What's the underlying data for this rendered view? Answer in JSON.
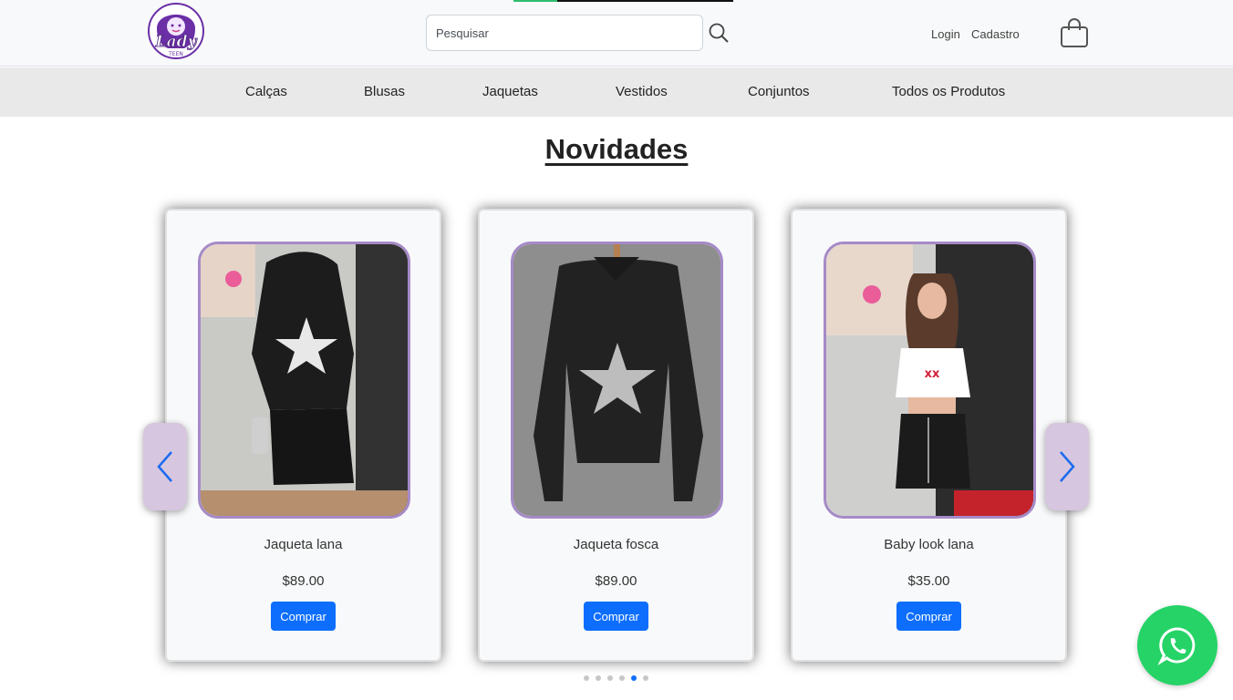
{
  "header": {
    "logo_text": "Lady",
    "logo_sub": "TEEN",
    "loading_progress": 0.2,
    "search": {
      "placeholder": "Pesquisar",
      "value": ""
    },
    "links": {
      "login": "Login",
      "signup": "Cadastro"
    },
    "icons": {
      "search": "search-icon",
      "cart": "shopping-bag-icon"
    }
  },
  "nav": {
    "categories": [
      "Calças",
      "Blusas",
      "Jaquetas",
      "Vestidos",
      "Conjuntos",
      "Todos os Produtos"
    ]
  },
  "section": {
    "title": "Novidades"
  },
  "products": [
    {
      "name": "Jaqueta lana",
      "price": "$89.00",
      "button": "Comprar"
    },
    {
      "name": "Jaqueta fosca",
      "price": "$89.00",
      "button": "Comprar"
    },
    {
      "name": "Baby look lana",
      "price": "$35.00",
      "button": "Comprar"
    }
  ],
  "carousel": {
    "dot_count": 6,
    "active_dot": 5,
    "icons": {
      "prev": "chevron-left-icon",
      "next": "chevron-right-icon"
    }
  },
  "whatsapp": {
    "icon": "whatsapp-icon"
  },
  "colors": {
    "accent": "#0d6efd",
    "frame": "#a58ac7",
    "arrow_bg": "#d6c6df",
    "whatsapp": "#25d366",
    "nav_bg": "#e9e9e9"
  }
}
